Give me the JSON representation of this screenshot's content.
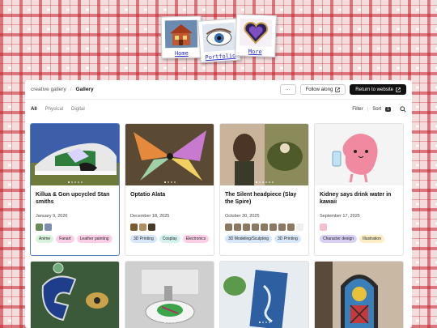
{
  "nav": {
    "home": "Home",
    "portfolio": "Portfolio",
    "more": "More"
  },
  "breadcrumb": {
    "site": "creative gallery",
    "page": "Gallery"
  },
  "toolbar": {
    "more_label": "···",
    "follow_label": "Follow along",
    "return_label": "Return to website"
  },
  "tabs": [
    "All",
    "Physical",
    "Digital"
  ],
  "filter": {
    "filter_label": "Filter",
    "sort_label": "Sort",
    "sort_count": "1"
  },
  "cards": [
    {
      "title": "Killua & Gon upcycled Stan smiths",
      "date": "January 9, 2026",
      "tags": [
        "Anime",
        "Fanart",
        "Leather painting"
      ]
    },
    {
      "title": "Optatio Alata",
      "date": "December 18, 2025",
      "tags": [
        "3D Printing",
        "Cosplay",
        "Electronics"
      ]
    },
    {
      "title": "The Silent headpiece (Slay the Spire)",
      "date": "October 30, 2025",
      "tags": [
        "3D Modeling/Sculpting",
        "3D Printing"
      ]
    },
    {
      "title": "Kidney says drink water in kawaii",
      "date": "September 17, 2025",
      "tags": [
        "Character design",
        "Illustration"
      ]
    }
  ],
  "colors": {
    "accent": "#5b80c8",
    "plaid_red": "#c4202c",
    "dark_button": "#111111"
  }
}
